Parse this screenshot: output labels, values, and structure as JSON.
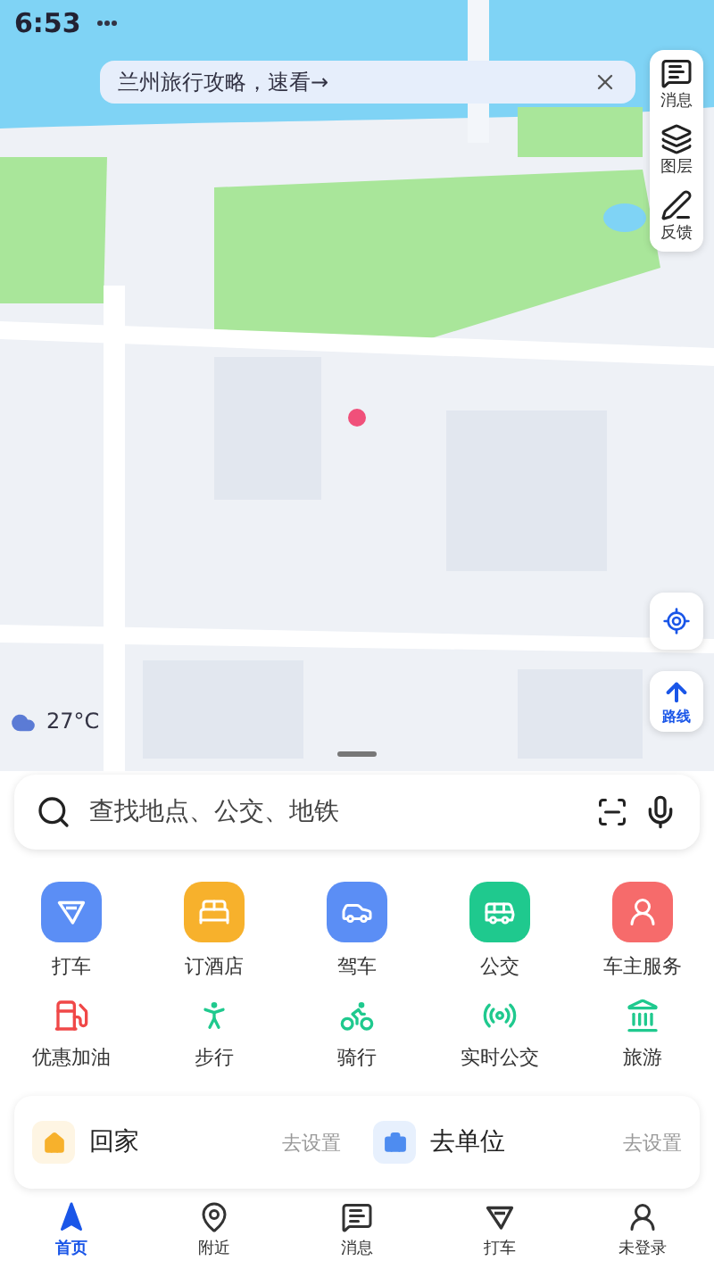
{
  "status_bar": {
    "time": "6:53"
  },
  "banner": {
    "text": "兰州旅行攻略，速看→"
  },
  "side_tools": [
    {
      "label": "消息"
    },
    {
      "label": "图层"
    },
    {
      "label": "反馈"
    }
  ],
  "map": {
    "kind": "picture",
    "weather": "27°C",
    "route_label": "路线"
  },
  "search": {
    "placeholder": "查找地点、公交、地铁"
  },
  "services": [
    {
      "label": "打车",
      "color": "#5b8ef5"
    },
    {
      "label": "订酒店",
      "color": "#f7b12c"
    },
    {
      "label": "驾车",
      "color": "#5b8ef5"
    },
    {
      "label": "公交",
      "color": "#1fc98e"
    },
    {
      "label": "车主服务",
      "color": "#f66b6b"
    }
  ],
  "tools": [
    {
      "label": "优惠加油",
      "color": "#f04848"
    },
    {
      "label": "步行",
      "color": "#1fc98e"
    },
    {
      "label": "骑行",
      "color": "#1fc98e"
    },
    {
      "label": "实时公交",
      "color": "#1fc98e"
    },
    {
      "label": "旅游",
      "color": "#1fc98e"
    }
  ],
  "shortcuts": [
    {
      "label": "回家",
      "action": "去设置",
      "color": "#f7b12c"
    },
    {
      "label": "去单位",
      "action": "去设置",
      "color": "#4e8cf0"
    }
  ],
  "tabs": [
    {
      "label": "首页",
      "selected": true
    },
    {
      "label": "附近",
      "selected": false
    },
    {
      "label": "消息",
      "selected": false
    },
    {
      "label": "打车",
      "selected": false
    },
    {
      "label": "未登录",
      "selected": false
    }
  ]
}
